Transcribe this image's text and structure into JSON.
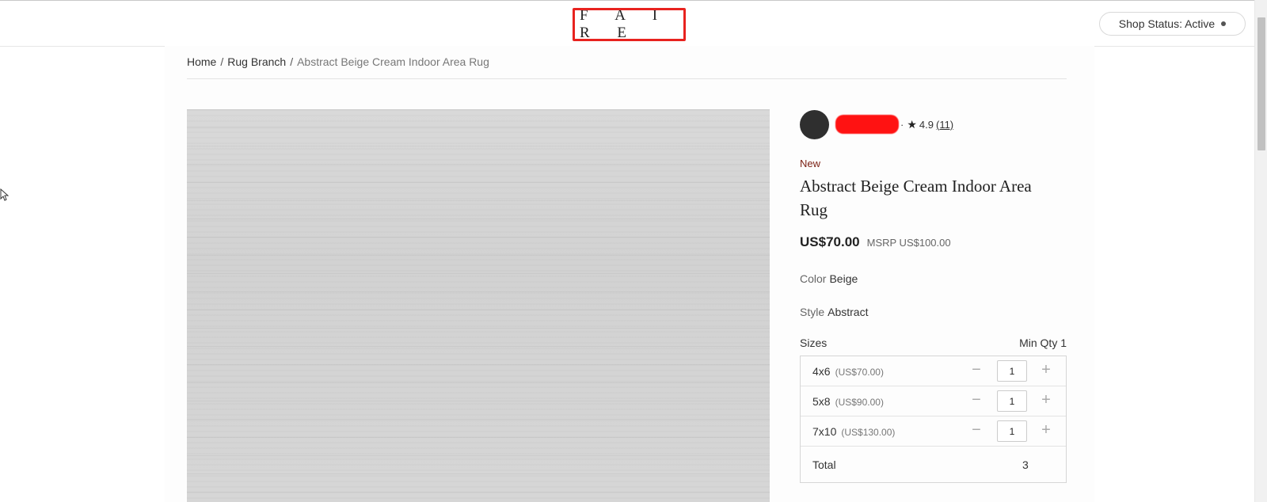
{
  "header": {
    "logo": "F A I R E",
    "shop_status": "Shop Status: Active"
  },
  "breadcrumb": {
    "home": "Home",
    "category": "Rug Branch",
    "current": "Abstract Beige Cream Indoor Area Rug"
  },
  "vendor": {
    "rating": "4.9",
    "rating_count": "(11)"
  },
  "product": {
    "badge": "New",
    "title": "Abstract Beige Cream Indoor Area Rug",
    "price": "US$70.00",
    "msrp": "MSRP US$100.00",
    "color_label": "Color",
    "color_value": "Beige",
    "style_label": "Style",
    "style_value": "Abstract"
  },
  "sizes": {
    "header": "Sizes",
    "min_qty": "Min Qty 1",
    "rows": [
      {
        "name": "4x6",
        "price": "(US$70.00)",
        "qty": "1"
      },
      {
        "name": "5x8",
        "price": "(US$90.00)",
        "qty": "1"
      },
      {
        "name": "7x10",
        "price": "(US$130.00)",
        "qty": "1"
      }
    ],
    "total_label": "Total",
    "total_value": "3"
  },
  "colors": {
    "highlight": "#e8231f",
    "new_badge": "#7a1f12",
    "redaction": "#ff1212"
  }
}
